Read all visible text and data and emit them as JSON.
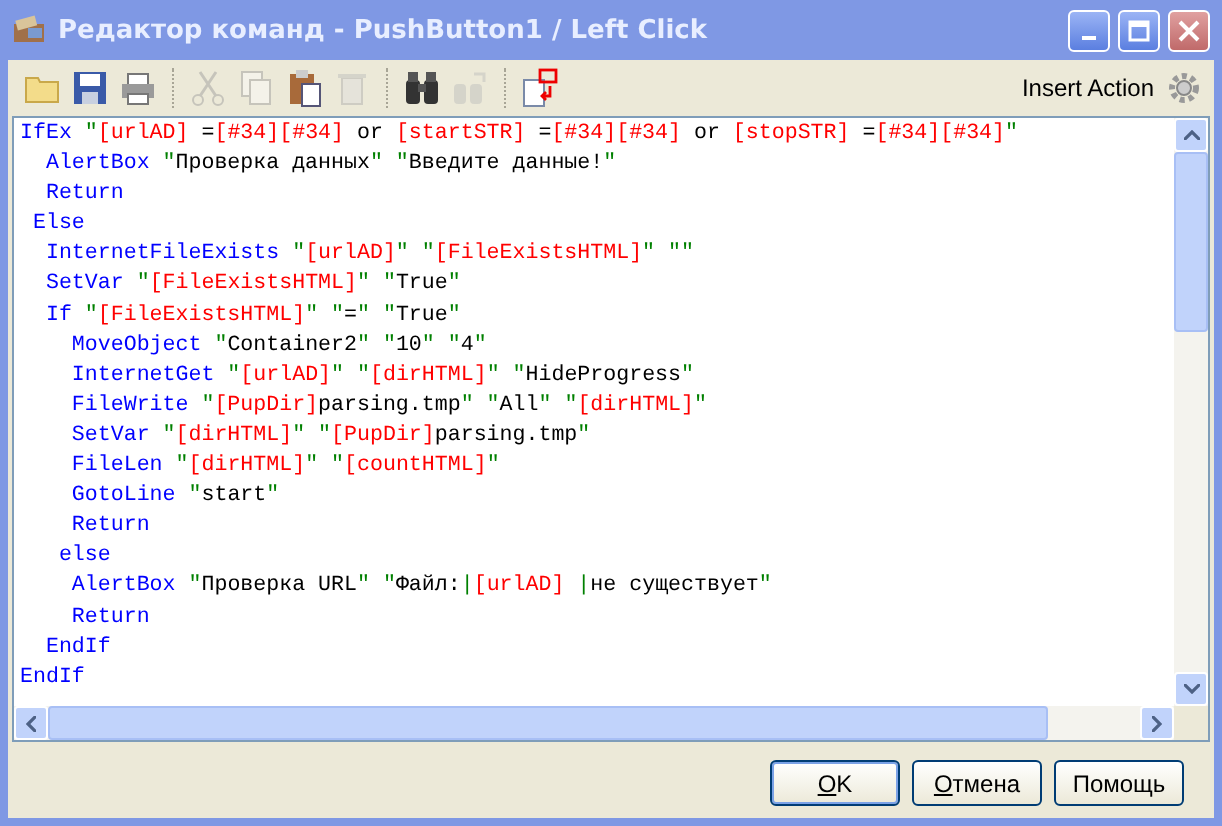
{
  "window": {
    "title": "Редактор команд - PushButton1 / Left Click"
  },
  "toolbar": [
    {
      "kind": "open",
      "disabled": false
    },
    {
      "kind": "save",
      "disabled": false
    },
    {
      "kind": "print",
      "disabled": false
    },
    {
      "kind": "separator"
    },
    {
      "kind": "cut",
      "disabled": true
    },
    {
      "kind": "copy",
      "disabled": true
    },
    {
      "kind": "paste",
      "disabled": false
    },
    {
      "kind": "delete",
      "disabled": true
    },
    {
      "kind": "separator"
    },
    {
      "kind": "find",
      "disabled": false
    },
    {
      "kind": "replace",
      "disabled": true
    },
    {
      "kind": "separator"
    },
    {
      "kind": "variable",
      "disabled": false
    }
  ],
  "insert_action": {
    "label": "Insert Action"
  },
  "code": [
    {
      "tokens": [
        {
          "kind": "keyword",
          "text": "IfEx"
        },
        {
          "kind": "quote",
          "text": " \""
        },
        {
          "kind": "variable",
          "text": "[urlAD]"
        },
        {
          "kind": "text",
          "text": " ="
        },
        {
          "kind": "variable",
          "text": "[#34][#34]"
        },
        {
          "kind": "text",
          "text": " or "
        },
        {
          "kind": "variable",
          "text": "[startSTR]"
        },
        {
          "kind": "text",
          "text": " ="
        },
        {
          "kind": "variable",
          "text": "[#34][#34]"
        },
        {
          "kind": "text",
          "text": " or "
        },
        {
          "kind": "variable",
          "text": "[stopSTR]"
        },
        {
          "kind": "text",
          "text": " ="
        },
        {
          "kind": "variable",
          "text": "[#34][#34]"
        },
        {
          "kind": "quote",
          "text": "\""
        }
      ]
    },
    {
      "tokens": [
        {
          "kind": "keyword",
          "text": "  AlertBox"
        },
        {
          "kind": "quote",
          "text": " \""
        },
        {
          "kind": "text",
          "text": "Проверка данных"
        },
        {
          "kind": "quote",
          "text": "\" \""
        },
        {
          "kind": "text",
          "text": "Введите данные!"
        },
        {
          "kind": "quote",
          "text": "\""
        }
      ]
    },
    {
      "tokens": [
        {
          "kind": "keyword",
          "text": "  Return"
        }
      ]
    },
    {
      "tokens": [
        {
          "kind": "keyword",
          "text": " Else"
        }
      ]
    },
    {
      "tokens": [
        {
          "kind": "keyword",
          "text": "  InternetFileExists"
        },
        {
          "kind": "quote",
          "text": " \""
        },
        {
          "kind": "variable",
          "text": "[urlAD]"
        },
        {
          "kind": "quote",
          "text": "\" \""
        },
        {
          "kind": "variable",
          "text": "[FileExistsHTML]"
        },
        {
          "kind": "quote",
          "text": "\" \"\""
        }
      ]
    },
    {
      "tokens": [
        {
          "kind": "keyword",
          "text": "  SetVar"
        },
        {
          "kind": "quote",
          "text": " \""
        },
        {
          "kind": "variable",
          "text": "[FileExistsHTML]"
        },
        {
          "kind": "quote",
          "text": "\" \""
        },
        {
          "kind": "text",
          "text": "True"
        },
        {
          "kind": "quote",
          "text": "\""
        }
      ]
    },
    {
      "tokens": [
        {
          "kind": "keyword",
          "text": "  If"
        },
        {
          "kind": "quote",
          "text": " \""
        },
        {
          "kind": "variable",
          "text": "[FileExistsHTML]"
        },
        {
          "kind": "quote",
          "text": "\" \""
        },
        {
          "kind": "text",
          "text": "="
        },
        {
          "kind": "quote",
          "text": "\" \""
        },
        {
          "kind": "text",
          "text": "True"
        },
        {
          "kind": "quote",
          "text": "\""
        }
      ]
    },
    {
      "tokens": [
        {
          "kind": "keyword",
          "text": "    MoveObject"
        },
        {
          "kind": "quote",
          "text": " \""
        },
        {
          "kind": "text",
          "text": "Container2"
        },
        {
          "kind": "quote",
          "text": "\" \""
        },
        {
          "kind": "text",
          "text": "10"
        },
        {
          "kind": "quote",
          "text": "\" \""
        },
        {
          "kind": "text",
          "text": "4"
        },
        {
          "kind": "quote",
          "text": "\""
        }
      ]
    },
    {
      "tokens": [
        {
          "kind": "keyword",
          "text": "    InternetGet"
        },
        {
          "kind": "quote",
          "text": " \""
        },
        {
          "kind": "variable",
          "text": "[urlAD]"
        },
        {
          "kind": "quote",
          "text": "\" \""
        },
        {
          "kind": "variable",
          "text": "[dirHTML]"
        },
        {
          "kind": "quote",
          "text": "\" \""
        },
        {
          "kind": "text",
          "text": "HideProgress"
        },
        {
          "kind": "quote",
          "text": "\""
        }
      ]
    },
    {
      "tokens": [
        {
          "kind": "keyword",
          "text": "    FileWrite"
        },
        {
          "kind": "quote",
          "text": " \""
        },
        {
          "kind": "variable",
          "text": "[PupDir]"
        },
        {
          "kind": "text",
          "text": "parsing.tmp"
        },
        {
          "kind": "quote",
          "text": "\" \""
        },
        {
          "kind": "text",
          "text": "All"
        },
        {
          "kind": "quote",
          "text": "\" \""
        },
        {
          "kind": "variable",
          "text": "[dirHTML]"
        },
        {
          "kind": "quote",
          "text": "\""
        }
      ]
    },
    {
      "tokens": [
        {
          "kind": "keyword",
          "text": "    SetVar"
        },
        {
          "kind": "quote",
          "text": " \""
        },
        {
          "kind": "variable",
          "text": "[dirHTML]"
        },
        {
          "kind": "quote",
          "text": "\" \""
        },
        {
          "kind": "variable",
          "text": "[PupDir]"
        },
        {
          "kind": "text",
          "text": "parsing.tmp"
        },
        {
          "kind": "quote",
          "text": "\""
        }
      ]
    },
    {
      "tokens": [
        {
          "kind": "keyword",
          "text": "    FileLen"
        },
        {
          "kind": "quote",
          "text": " \""
        },
        {
          "kind": "variable",
          "text": "[dirHTML]"
        },
        {
          "kind": "quote",
          "text": "\" \""
        },
        {
          "kind": "variable",
          "text": "[countHTML]"
        },
        {
          "kind": "quote",
          "text": "\""
        }
      ]
    },
    {
      "tokens": [
        {
          "kind": "keyword",
          "text": "    GotoLine"
        },
        {
          "kind": "quote",
          "text": " \""
        },
        {
          "kind": "text",
          "text": "start"
        },
        {
          "kind": "quote",
          "text": "\""
        }
      ]
    },
    {
      "tokens": [
        {
          "kind": "keyword",
          "text": "    Return"
        }
      ]
    },
    {
      "tokens": [
        {
          "kind": "keyword",
          "text": "   else"
        }
      ]
    },
    {
      "tokens": [
        {
          "kind": "keyword",
          "text": "    AlertBox"
        },
        {
          "kind": "quote",
          "text": " \""
        },
        {
          "kind": "text",
          "text": "Проверка URL"
        },
        {
          "kind": "quote",
          "text": "\" \""
        },
        {
          "kind": "text",
          "text": "Файл:"
        },
        {
          "kind": "quote",
          "text": "|"
        },
        {
          "kind": "variable",
          "text": "[urlAD]"
        },
        {
          "kind": "quote",
          "text": " |"
        },
        {
          "kind": "text",
          "text": "не существует"
        },
        {
          "kind": "quote",
          "text": "\""
        }
      ]
    },
    {
      "tokens": [
        {
          "kind": "keyword",
          "text": "    Return"
        }
      ]
    },
    {
      "tokens": [
        {
          "kind": "keyword",
          "text": "  EndIf"
        }
      ]
    },
    {
      "tokens": [
        {
          "kind": "keyword",
          "text": "EndIf"
        }
      ]
    }
  ],
  "buttons": [
    {
      "label": "OK",
      "default": true,
      "underline_first": true
    },
    {
      "label": "Отмена",
      "default": false,
      "underline_first": true
    },
    {
      "label": "Помощь",
      "default": false,
      "underline_first": false
    }
  ]
}
